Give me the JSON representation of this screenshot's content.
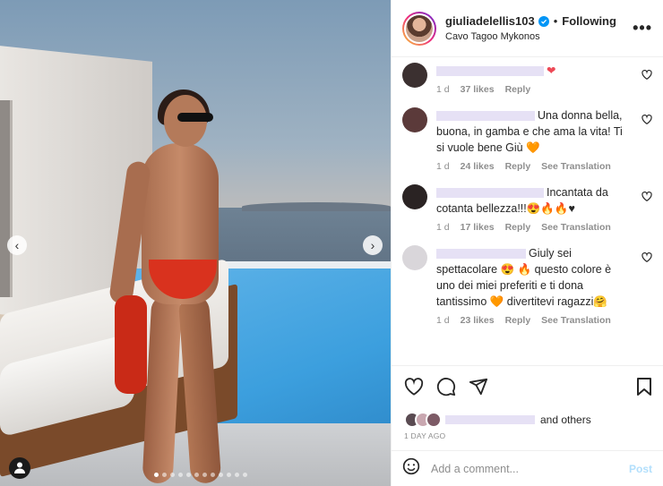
{
  "header": {
    "username": "giuliadelellis103",
    "separator": "•",
    "follow_status": "Following",
    "location": "Cavo Tagoo Mykonos",
    "more_label": "•••"
  },
  "photo": {
    "prev_label": "‹",
    "next_label": "›",
    "carousel_count": 12,
    "carousel_active": 0
  },
  "comments": [
    {
      "text_suffix": "",
      "emoji": "❤",
      "age": "1 d",
      "likes": "37 likes",
      "reply": "Reply",
      "translation": ""
    },
    {
      "text_suffix": "Una donna bella, buona, in gamba e che ama la vita! Ti si vuole bene Giù 🧡",
      "emoji": "",
      "age": "1 d",
      "likes": "24 likes",
      "reply": "Reply",
      "translation": "See Translation"
    },
    {
      "text_suffix": "Incantata da cotanta bellezza!!!😍🔥🔥♥",
      "emoji": "",
      "age": "1 d",
      "likes": "17 likes",
      "reply": "Reply",
      "translation": "See Translation"
    },
    {
      "text_suffix": "Giuly sei spettacolare 😍 🔥 questo colore è uno dei miei preferiti e ti dona tantissimo 🧡 divertitevi ragazzi🤗",
      "emoji": "",
      "age": "1 d",
      "likes": "23 likes",
      "reply": "Reply",
      "translation": "See Translation"
    }
  ],
  "likes_line": {
    "suffix": "and others",
    "timestamp": "1 DAY AGO"
  },
  "composer": {
    "placeholder": "Add a comment...",
    "post_label": "Post"
  },
  "colors": {
    "accent_blue": "#0095f6",
    "post_disabled": "#b2dffc",
    "heart_red": "#ed4956"
  }
}
